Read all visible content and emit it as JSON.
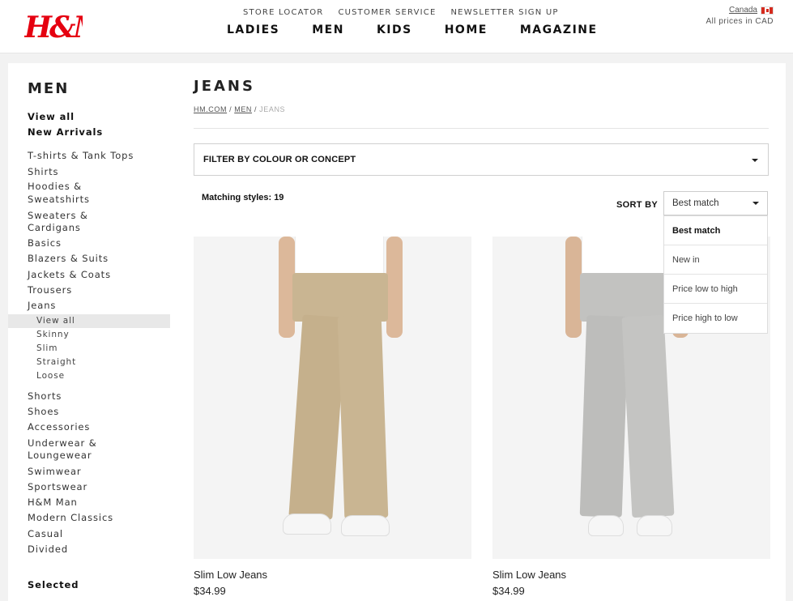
{
  "header": {
    "logo": "H&M",
    "top_links": [
      "STORE LOCATOR",
      "CUSTOMER SERVICE",
      "NEWSLETTER SIGN UP"
    ],
    "nav": [
      "LADIES",
      "MEN",
      "KIDS",
      "HOME",
      "MAGAZINE"
    ],
    "country": "Canada",
    "prices_note": "All prices in CAD"
  },
  "sidebar": {
    "title": "MEN",
    "primary": [
      "View all",
      "New Arrivals"
    ],
    "categories_a": [
      "T-shirts & Tank Tops",
      "Shirts",
      "Hoodies &",
      "Sweatshirts",
      "Sweaters &",
      "Cardigans",
      "Basics",
      "Blazers & Suits",
      "Jackets & Coats",
      "Trousers",
      "Jeans"
    ],
    "jeans_sub": [
      "View all",
      "Skinny",
      "Slim",
      "Straight",
      "Loose"
    ],
    "categories_b": [
      "Shorts",
      "Shoes",
      "Accessories",
      "Underwear &",
      "Loungewear",
      "Swimwear",
      "Sportswear",
      "H&M Man",
      "Modern Classics",
      "Casual",
      "Divided"
    ],
    "selected_title": "Selected"
  },
  "main": {
    "title": "JEANS",
    "breadcrumb": [
      "HM.COM",
      "MEN",
      "JEANS"
    ],
    "filter_label": "FILTER BY COLOUR OR CONCEPT",
    "matching_label": "Matching styles:",
    "matching_count": "19",
    "sort_label": "SORT BY",
    "sort_value": "Best match",
    "sort_options": [
      "Best match",
      "New in",
      "Price low to high",
      "Price high to low"
    ]
  },
  "products": [
    {
      "name": "Slim Low Jeans",
      "price": "$34.99",
      "color": "#c9b592"
    },
    {
      "name": "Slim Low Jeans",
      "price": "$34.99",
      "color": "#c2c2c0"
    }
  ],
  "colors": {
    "brand": "#e50010",
    "panel_bg": "#ffffff",
    "page_bg": "#f2f2f2"
  }
}
